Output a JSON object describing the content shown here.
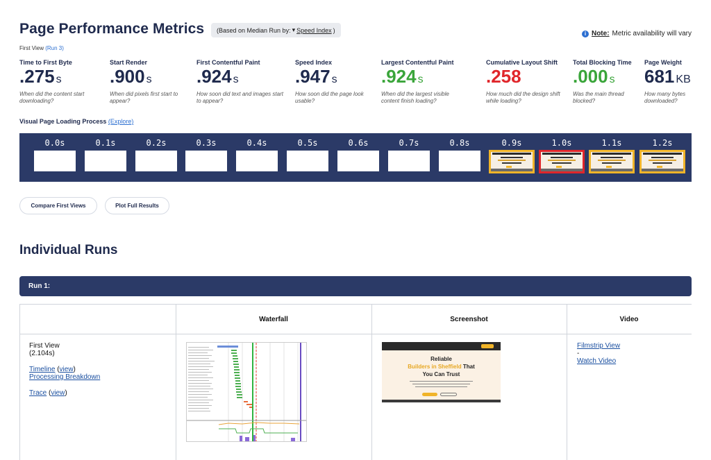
{
  "header": {
    "title": "Page Performance Metrics",
    "median_prefix": "(Based on Median Run by:",
    "median_selected": "Speed Index",
    "median_suffix": ")",
    "note_label": "Note:",
    "note_text": "Metric availability will vary",
    "first_view_label": "First View",
    "first_view_run": "(Run 3)"
  },
  "metrics": [
    {
      "label": "Time to First Byte",
      "value": ".275",
      "unit": "s",
      "desc": "When did the content start downloading?",
      "color": "#1f2a4d"
    },
    {
      "label": "Start Render",
      "value": ".900",
      "unit": "s",
      "desc": "When did pixels first start to appear?",
      "color": "#1f2a4d"
    },
    {
      "label": "First Contentful Paint",
      "value": ".924",
      "unit": "s",
      "desc": "How soon did text and images start to appear?",
      "color": "#1f2a4d"
    },
    {
      "label": "Speed Index",
      "value": ".947",
      "unit": "s",
      "desc": "How soon did the page look usable?",
      "color": "#1f2a4d"
    },
    {
      "label": "Largest Contentful Paint",
      "value": ".924",
      "unit": "s",
      "desc": "When did the largest visible content finish loading?",
      "color": "#3aa53a"
    },
    {
      "label": "Cumulative Layout Shift",
      "value": ".258",
      "unit": "",
      "desc": "How much did the design shift while loading?",
      "color": "#e0262b"
    },
    {
      "label": "Total Blocking Time",
      "value": ".000",
      "unit": "s",
      "desc": "Was the main thread blocked?",
      "color": "#3aa53a"
    },
    {
      "label": "Page Weight",
      "value": "681",
      "unit": "KB",
      "desc": "How many bytes downloaded?",
      "color": "#1f2a4d"
    }
  ],
  "visual": {
    "label": "Visual Page Loading Process",
    "explore": "(Explore)",
    "frames": [
      "0.0s",
      "0.1s",
      "0.2s",
      "0.3s",
      "0.4s",
      "0.5s",
      "0.6s",
      "0.7s",
      "0.8s",
      "0.9s",
      "1.0s",
      "1.1s",
      "1.2s"
    ]
  },
  "buttons": {
    "compare": "Compare First Views",
    "plot": "Plot Full Results"
  },
  "runs": {
    "title": "Individual Runs",
    "run_label": "Run 1:",
    "columns": [
      "Waterfall",
      "Screenshot",
      "Video"
    ],
    "first_view": "First View",
    "duration": "(2.104s)",
    "timeline": "Timeline",
    "timeline_view": "view",
    "processing": "Processing Breakdown",
    "trace": "Trace",
    "trace_view": "view",
    "filmstrip": "Filmstrip View",
    "dash": "-",
    "watch": "Watch Video"
  },
  "screenshot": {
    "line1": "Reliable",
    "line2_highlight": "Builders in Sheffield",
    "line2_rest": "That",
    "line3": "You Can Trust"
  },
  "colors": {
    "navy": "#2b3a67",
    "good": "#3aa53a",
    "bad": "#e0262b",
    "frame_highlight": "#f0b429"
  }
}
